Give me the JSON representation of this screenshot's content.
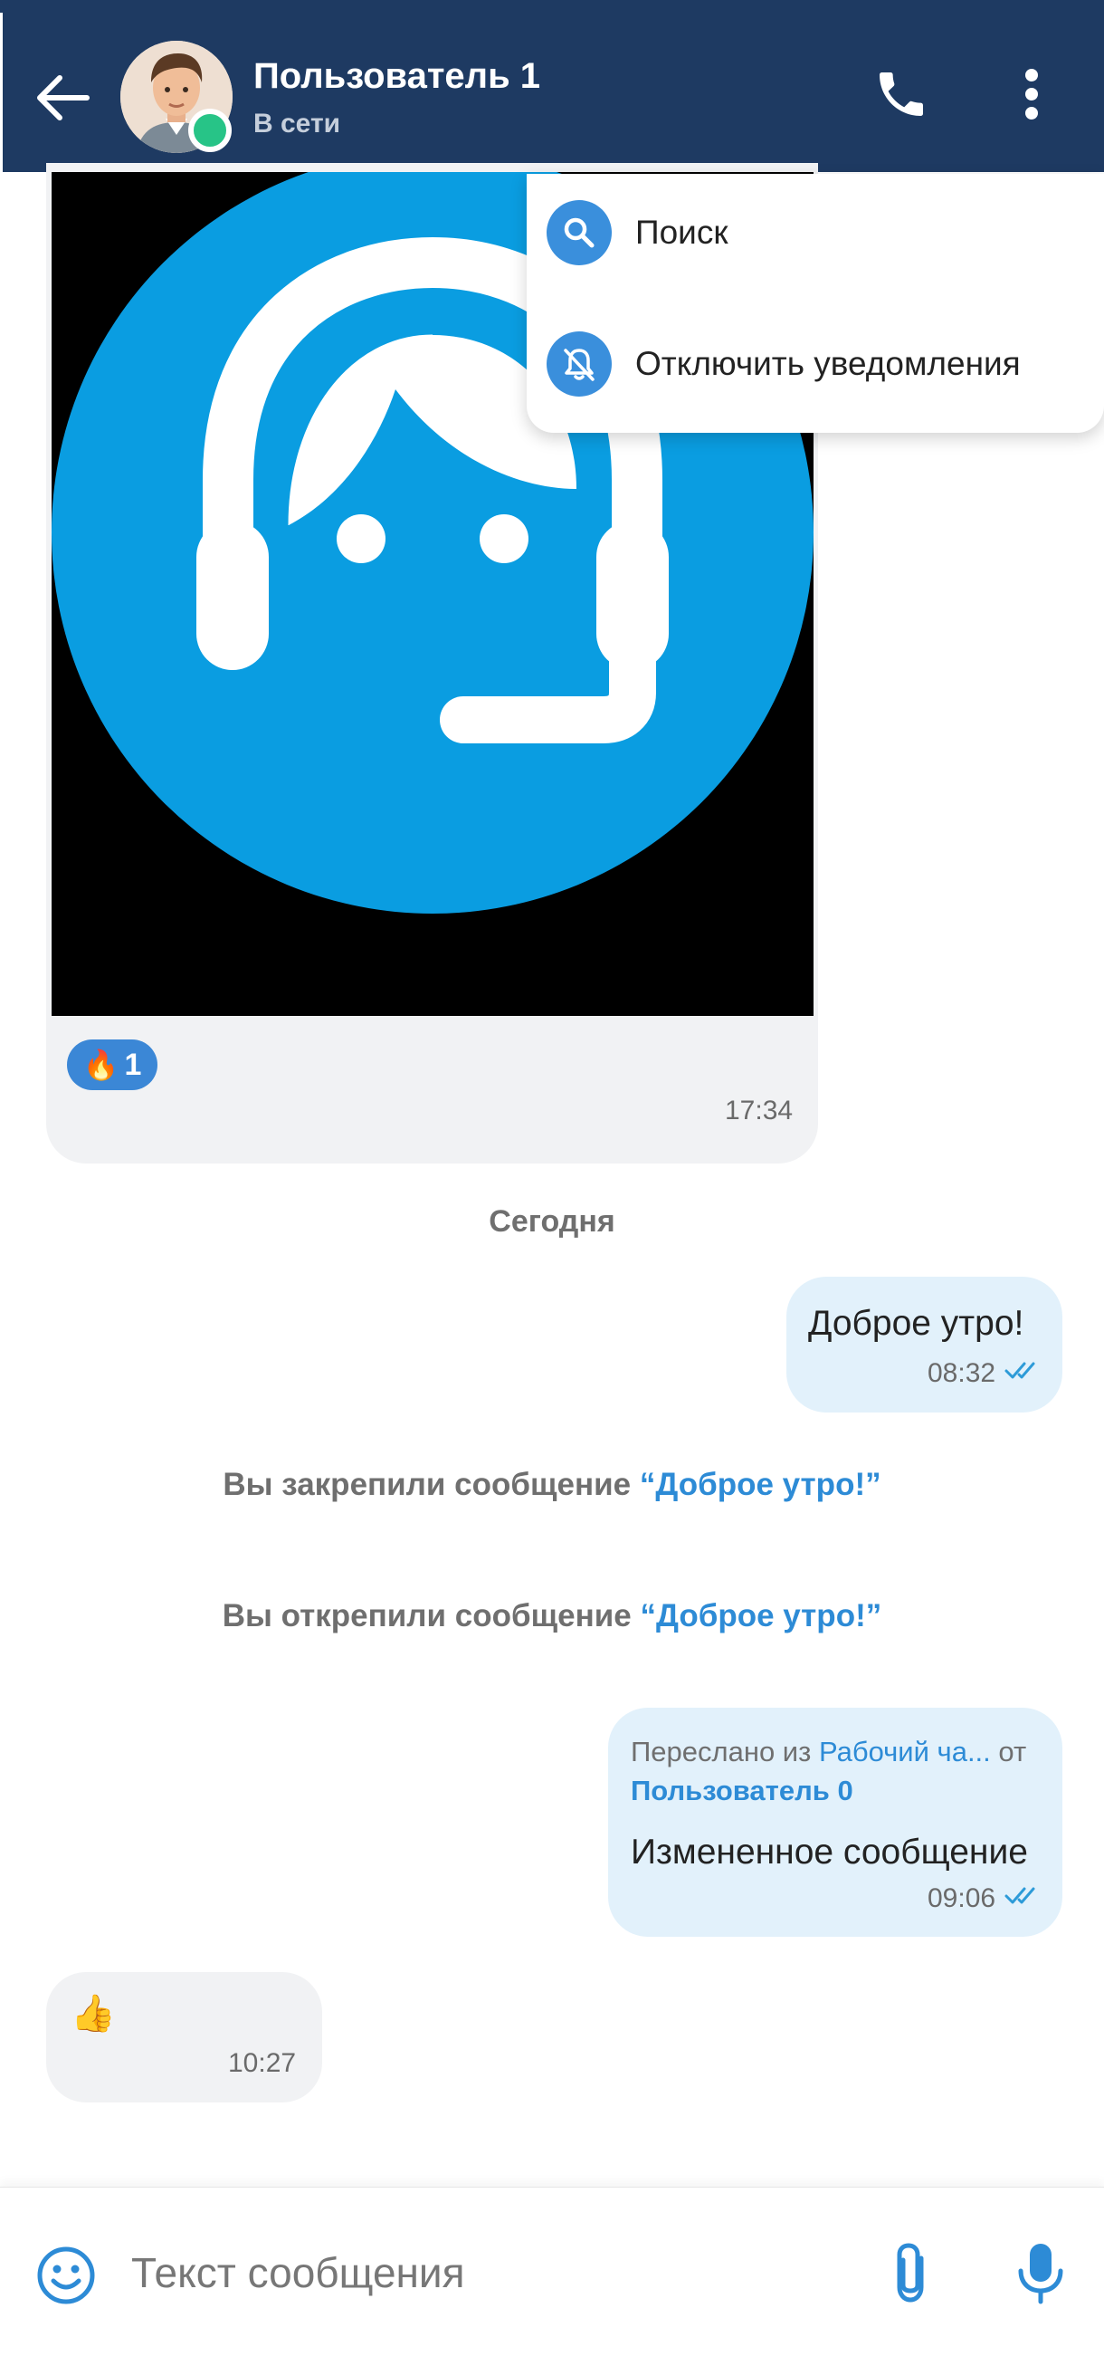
{
  "header": {
    "contact_name": "Пользователь 1",
    "contact_status": "В сети",
    "bg_color": "#1e3a62",
    "online_color": "#27c487",
    "icons": [
      "back-arrow-icon",
      "phone-icon",
      "more-vertical-icon"
    ]
  },
  "menu": {
    "items": [
      {
        "label": "Поиск",
        "icon": "search-icon"
      },
      {
        "label": "Отключить уведомления",
        "icon": "bell-off-icon"
      }
    ]
  },
  "messages": {
    "media": {
      "reaction_emoji": "🔥",
      "reaction_count": "1",
      "time": "17:34"
    },
    "day_divider": "Сегодня",
    "morning": {
      "text": "Доброе утро!",
      "time": "08:32"
    },
    "pinned": {
      "prefix": "Вы закрепили сообщение ",
      "quote": "“Доброе утро!”"
    },
    "unpinned": {
      "prefix": "Вы открепили сообщение ",
      "quote": "“Доброе утро!”"
    },
    "forwarded": {
      "prefix": "Переслано из ",
      "chat": "Рабочий ча...",
      "from": " от",
      "user": "Пользователь 0",
      "text": "Измененное сообщение",
      "time": "09:06"
    },
    "like": {
      "emoji": "👍",
      "time": "10:27"
    }
  },
  "composer": {
    "placeholder": "Текст сообщения",
    "icons": [
      "emoji-icon",
      "paperclip-icon",
      "microphone-icon"
    ]
  },
  "colors": {
    "accent": "#2d8bd6",
    "outgoing_bubble": "#e2f1fb",
    "incoming_bubble": "#f1f2f4",
    "image_circle": "#0a9de1"
  }
}
